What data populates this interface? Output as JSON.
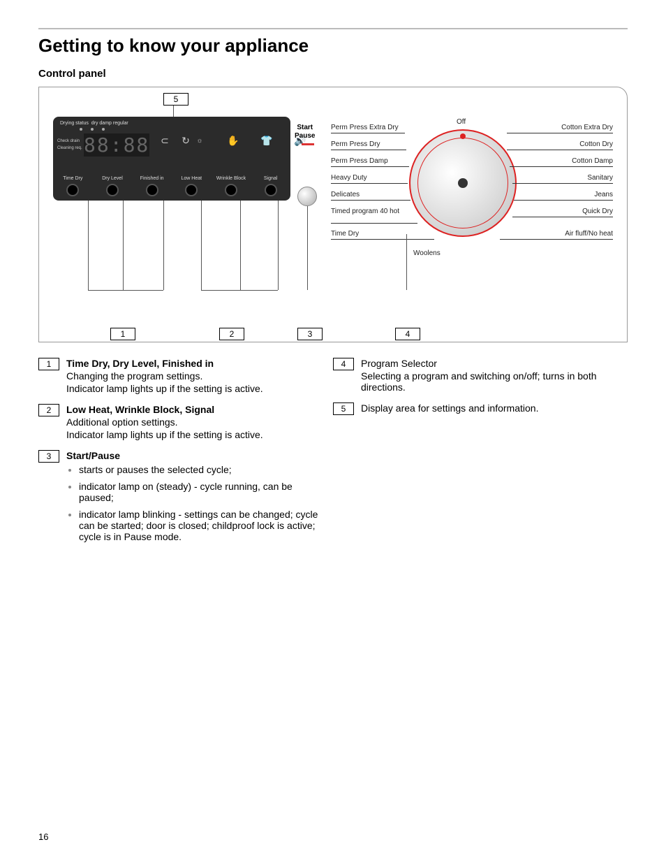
{
  "page_number": "16",
  "heading": "Getting to know your appliance",
  "subheading": "Control panel",
  "callouts": {
    "top": "5",
    "b1": "1",
    "b2": "2",
    "b3": "3",
    "b4": "4"
  },
  "display": {
    "statusLabel": "Drying status",
    "statusLevels": "dry    damp  regular",
    "side1": "Check drain",
    "side2": "Cleaning req.",
    "seg": "88:88",
    "iconKey": "⊂",
    "iconRefresh": "↻",
    "iconSun": "☼",
    "iconHand": "✋",
    "iconShirt": "👕",
    "iconSound": "🔊",
    "buttons": [
      "Time Dry",
      "Dry Level",
      "Finished in",
      "Low Heat",
      "Wrinkle Block",
      "Signal"
    ]
  },
  "startpause": {
    "line1": "Start",
    "line2": "Pause"
  },
  "programs_left": [
    "Perm Press Extra Dry",
    "Perm Press Dry",
    "Perm Press Damp",
    "Heavy Duty",
    "Delicates",
    "Timed program 40 hot",
    "Time Dry"
  ],
  "programs_top": "Off",
  "programs_right": [
    "Cotton Extra Dry",
    "Cotton Dry",
    "Cotton Damp",
    "Sanitary",
    "Jeans",
    "Quick Dry",
    "Air fluff/No heat"
  ],
  "programs_bottom": "Woolens",
  "legend": {
    "l1": {
      "num": "1",
      "title": "Time Dry, Dry Level, Finished in",
      "p1": "Changing the program settings.",
      "p2": "Indicator lamp lights up if the setting is active."
    },
    "l2": {
      "num": "2",
      "title": "Low Heat, Wrinkle Block, Signal",
      "p1": "Additional option settings.",
      "p2": "Indicator lamp lights up if the setting is active."
    },
    "l3": {
      "num": "3",
      "title": "Start/Pause",
      "b1": "starts or pauses the selected cycle;",
      "b2": "indicator lamp on (steady) - cycle running, can be paused;",
      "b3": "indicator lamp blinking - settings can be changed; cycle can be started; door is closed; childproof lock is active; cycle is in Pause mode."
    },
    "l4": {
      "num": "4",
      "title": "Program Selector",
      "p1": "Selecting a program and switching on/off; turns in both directions."
    },
    "l5": {
      "num": "5",
      "p1": "Display area for settings and information."
    }
  }
}
